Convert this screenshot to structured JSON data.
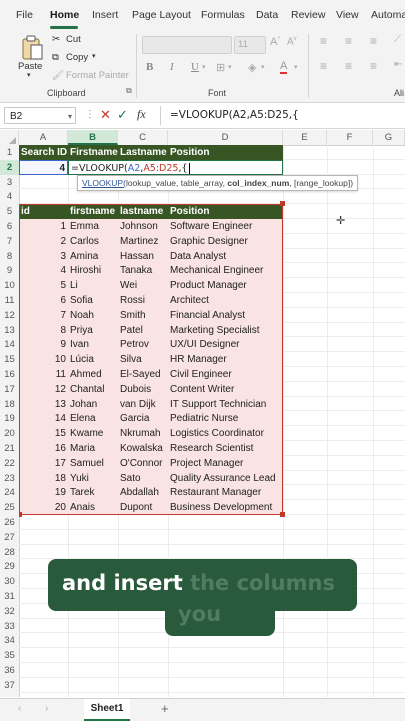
{
  "ribbon_tabs": [
    "File",
    "Home",
    "Insert",
    "Page Layout",
    "Formulas",
    "Data",
    "Review",
    "View",
    "Automa"
  ],
  "clipboard": {
    "paste": "Paste",
    "cut": "Cut",
    "copy": "Copy",
    "format_painter": "Format Painter",
    "group": "Clipboard"
  },
  "font_group": {
    "group": "Font",
    "size": "11",
    "bold": "B",
    "italic": "I",
    "underline": "U"
  },
  "alignment_group": {
    "group": "Ali"
  },
  "formula_bar": {
    "name_box": "B2",
    "fx": "fx",
    "formula": "=VLOOKUP(A2,A5:D25,{"
  },
  "columns": [
    "A",
    "B",
    "C",
    "D",
    "E",
    "F",
    "G"
  ],
  "selected_column": "B",
  "rows": [
    "1",
    "2",
    "3",
    "4",
    "5",
    "6",
    "7",
    "8",
    "9",
    "10",
    "11",
    "12",
    "13",
    "14",
    "15",
    "16",
    "17",
    "18",
    "19",
    "20",
    "21",
    "22",
    "23",
    "24",
    "25",
    "26",
    "27",
    "28",
    "29",
    "30",
    "31",
    "32",
    "33",
    "34",
    "35",
    "36",
    "37"
  ],
  "selected_row": "2",
  "lookup_header": [
    "Search ID",
    "Firstname",
    "Lastname",
    "Position"
  ],
  "lookup_row": {
    "search_id": "4",
    "editing_prefix": "=VLOOKUP(",
    "editing_a2": "A2",
    "editing_comma1": ",",
    "editing_range": "A5:D25",
    "editing_suffix": ",{"
  },
  "tooltip": {
    "func": "VLOOKUP(",
    "arg1": "lookup_value, table_array, ",
    "arg_current": "col_index_num",
    "arg_rest": ", [range_lookup])"
  },
  "table": {
    "headers": [
      "id",
      "firstname",
      "lastname",
      "Position"
    ],
    "rows": [
      [
        "1",
        "Emma",
        "Johnson",
        "Software Engineer"
      ],
      [
        "2",
        "Carlos",
        "Martinez",
        "Graphic Designer"
      ],
      [
        "3",
        "Amina",
        "Hassan",
        "Data Analyst"
      ],
      [
        "4",
        "Hiroshi",
        "Tanaka",
        "Mechanical Engineer"
      ],
      [
        "5",
        "Li",
        "Wei",
        "Product Manager"
      ],
      [
        "6",
        "Sofia",
        "Rossi",
        "Architect"
      ],
      [
        "7",
        "Noah",
        "Smith",
        "Financial Analyst"
      ],
      [
        "8",
        "Priya",
        "Patel",
        "Marketing Specialist"
      ],
      [
        "9",
        "Ivan",
        "Petrov",
        "UX/UI Designer"
      ],
      [
        "10",
        "Lúcia",
        "Silva",
        "HR Manager"
      ],
      [
        "11",
        "Ahmed",
        "El-Sayed",
        "Civil Engineer"
      ],
      [
        "12",
        "Chantal",
        "Dubois",
        "Content Writer"
      ],
      [
        "13",
        "Johan",
        "van Dijk",
        "IT Support Technician"
      ],
      [
        "14",
        "Elena",
        "Garcia",
        "Pediatric Nurse"
      ],
      [
        "15",
        "Kwame",
        "Nkrumah",
        "Logistics Coordinator"
      ],
      [
        "16",
        "Maria",
        "Kowalska",
        "Research Scientist"
      ],
      [
        "17",
        "Samuel",
        "O'Connor",
        "Project Manager"
      ],
      [
        "18",
        "Yuki",
        "Sato",
        "Quality Assurance Lead"
      ],
      [
        "19",
        "Tarek",
        "Abdallah",
        "Restaurant Manager"
      ],
      [
        "20",
        "Anais",
        "Dupont",
        "Business Development"
      ]
    ]
  },
  "sheet_tab": "Sheet1",
  "add_sheet": "+",
  "caption": {
    "visible": "and insert ",
    "faint": "the columns",
    "line2": "you"
  },
  "colors": {
    "accent": "#217346",
    "header_fill": "#375623",
    "table_fill": "#f9e3e3",
    "caption_bg": "#2a5a3c"
  }
}
